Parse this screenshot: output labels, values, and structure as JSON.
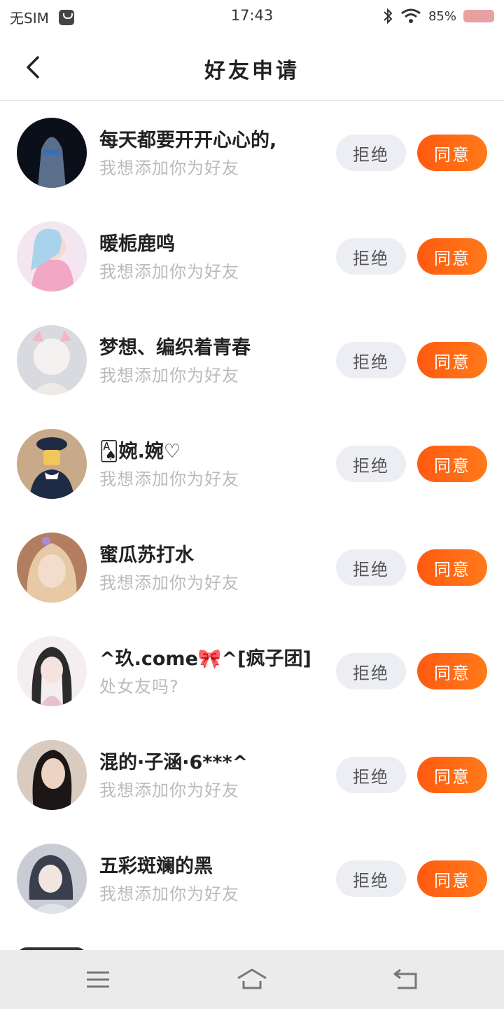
{
  "status_bar": {
    "carrier": "无SIM",
    "time": "17:43",
    "battery": "85%"
  },
  "header": {
    "title": "好友申请"
  },
  "buttons": {
    "reject": "拒绝",
    "accept": "同意"
  },
  "requests": [
    {
      "name": "每天都要开开心心的,",
      "message": "我想添加你为好友",
      "avatar_colors": [
        "#0a0f1a",
        "#3a6fb5"
      ]
    },
    {
      "name": "暖栀鹿鸣",
      "message": "我想添加你为好友",
      "avatar_colors": [
        "#f3e6f0",
        "#f2a7c3"
      ]
    },
    {
      "name": "梦想、编织着青春",
      "message": "我想添加你为好友",
      "avatar_colors": [
        "#d8dadf",
        "#f1b7c4"
      ]
    },
    {
      "name": "🂡婉.婉♡",
      "message": "我想添加你为好友",
      "avatar_colors": [
        "#c8a98a",
        "#1f2a44"
      ]
    },
    {
      "name": "蜜瓜苏打水",
      "message": "我想添加你为好友",
      "avatar_colors": [
        "#e7c9a6",
        "#b37d62"
      ]
    },
    {
      "name": "^玖.come🎀^[疯子团]",
      "message": "处女友吗?",
      "avatar_colors": [
        "#f4eef0",
        "#2b2b2e"
      ]
    },
    {
      "name": "混的·子涵·6***^",
      "message": "我想添加你为好友",
      "avatar_colors": [
        "#d9cbbf",
        "#1b1717"
      ]
    },
    {
      "name": "五彩斑斓的黑",
      "message": "我想添加你为好友",
      "avatar_colors": [
        "#c9ccd4",
        "#3a3f4d"
      ]
    }
  ]
}
